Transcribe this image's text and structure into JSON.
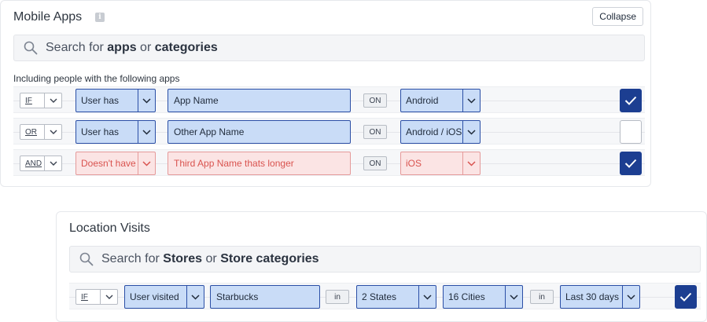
{
  "mobile_apps": {
    "title": "Mobile Apps",
    "collapse_label": "Collapse",
    "search": {
      "prefix": "Search for ",
      "term1": "apps",
      "mid": " or ",
      "term2": "categories"
    },
    "subheading": "Including people with the following apps",
    "rows": [
      {
        "logic": "IF",
        "condition": "User has",
        "app": "App Name",
        "on_label": "ON",
        "platform": "Android",
        "checked": true,
        "error": false
      },
      {
        "logic": "OR",
        "condition": "User has",
        "app": "Other App Name",
        "on_label": "ON",
        "platform": "Android / iOS",
        "checked": false,
        "error": false
      },
      {
        "logic": "AND",
        "condition": "Doesn't have",
        "app": "Third App Name thats longer",
        "on_label": "ON",
        "platform": "iOS",
        "checked": true,
        "error": true
      }
    ]
  },
  "location_visits": {
    "title": "Location Visits",
    "search": {
      "prefix": "Search for ",
      "term1": "Stores",
      "mid": " or ",
      "term2": "Store categories"
    },
    "row": {
      "logic": "IF",
      "condition": "User visited",
      "store": "Starbucks",
      "in_label_1": "in",
      "states": "2 States",
      "cities": "16 Cities",
      "in_label_2": "in",
      "period": "Last 30 days",
      "checked": true
    }
  },
  "colors": {
    "accent": "#1c3e91",
    "field_fill": "#c9dcf7",
    "field_border": "#2b4fa6",
    "error_fill": "#fbe4e4",
    "error_text": "#d9534f"
  }
}
